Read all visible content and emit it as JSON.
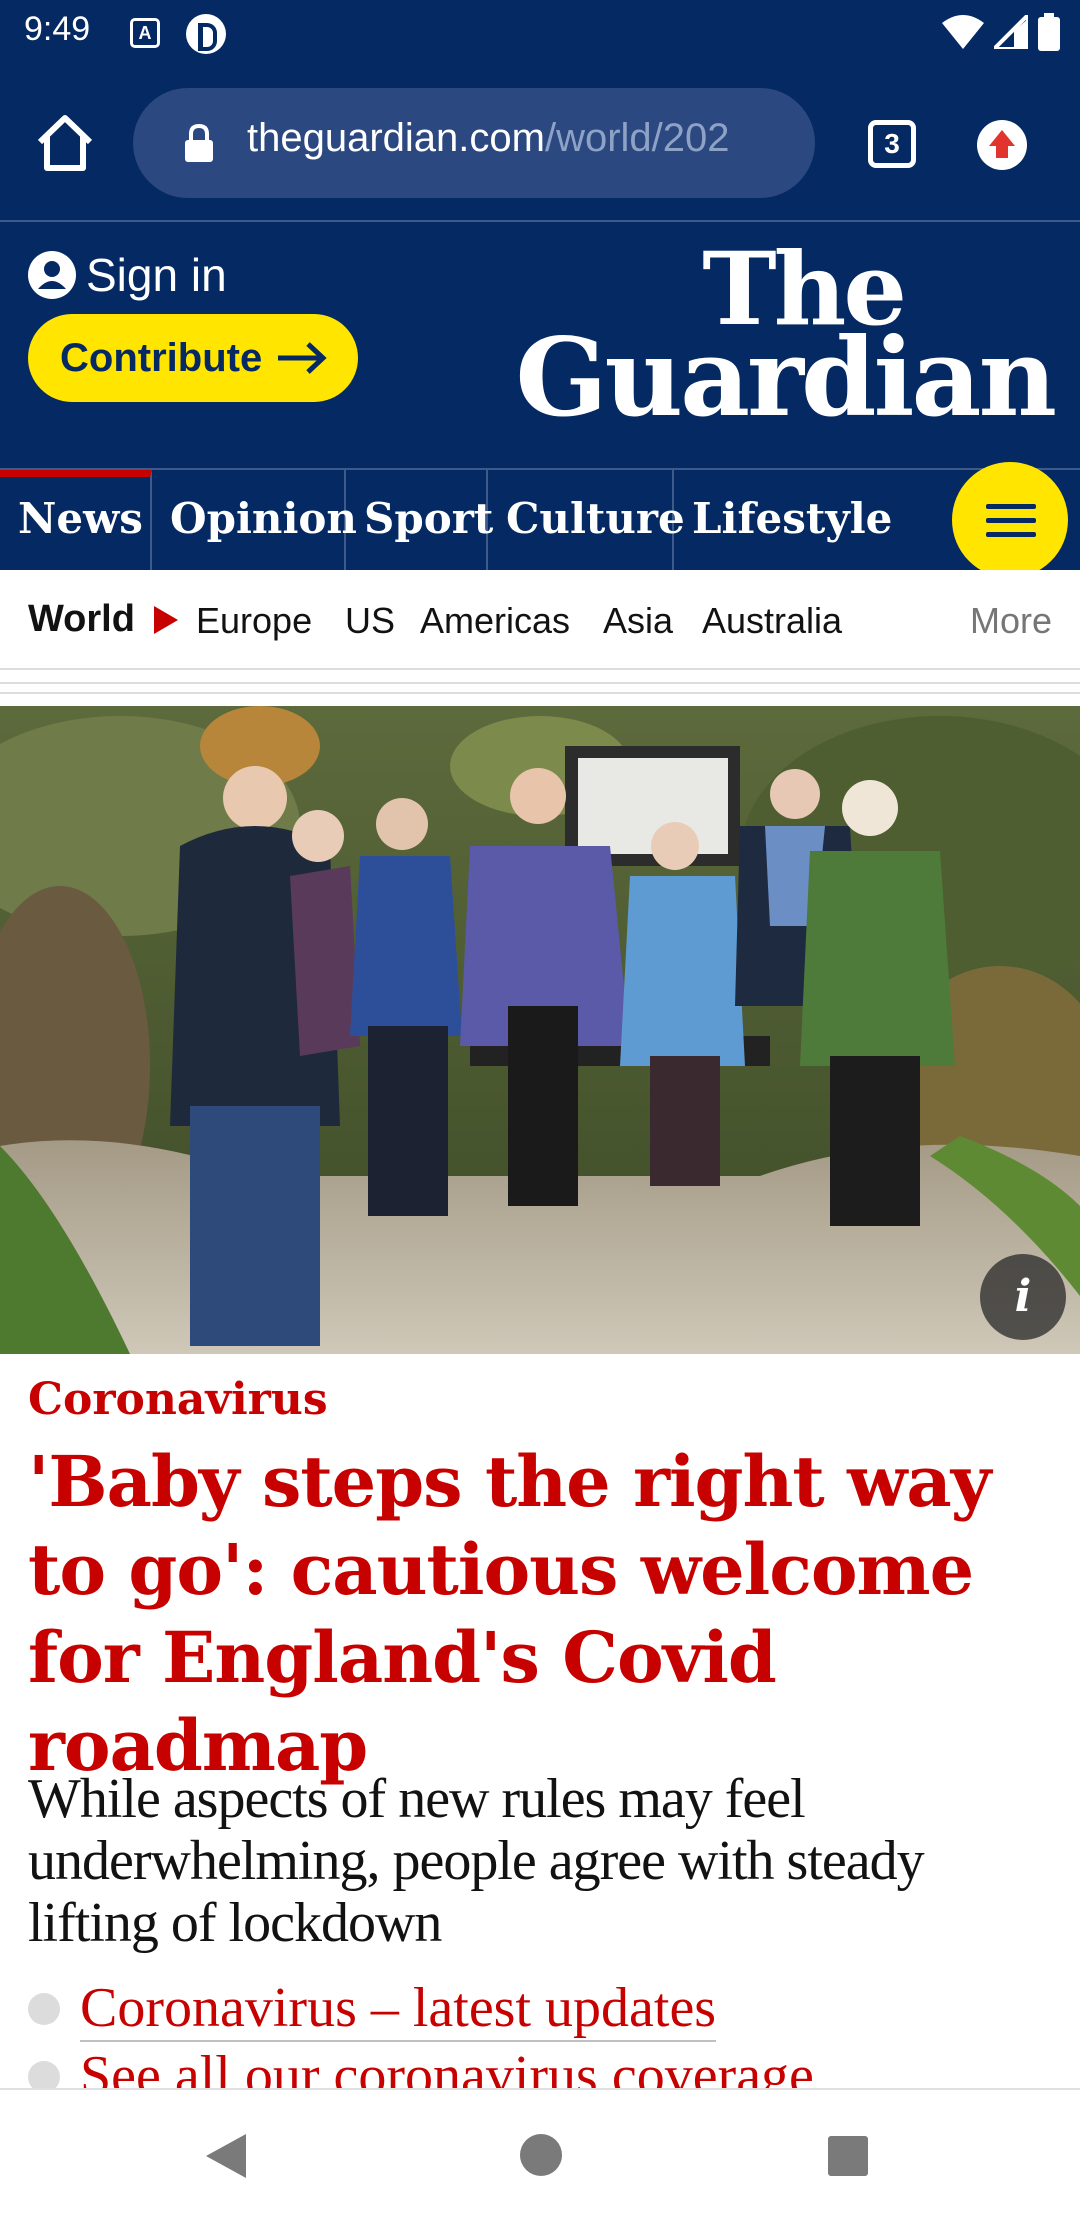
{
  "status_bar": {
    "time": "9:49",
    "icon_a": "A"
  },
  "browser": {
    "url_domain": "theguardian.com",
    "url_path": "/world/202",
    "tab_count": "3"
  },
  "header": {
    "sign_in": "Sign in",
    "contribute": "Contribute",
    "logo_line1": "The",
    "logo_line2": "Guardian"
  },
  "nav": {
    "items": [
      {
        "label": "News"
      },
      {
        "label": "Opinion"
      },
      {
        "label": "Sport"
      },
      {
        "label": "Culture"
      },
      {
        "label": "Lifestyle"
      }
    ]
  },
  "subnav": {
    "section": "World",
    "items": [
      "Europe",
      "US",
      "Americas",
      "Asia",
      "Australia"
    ],
    "more": "More"
  },
  "article": {
    "kicker": "Coronavirus",
    "headline": "'Baby steps the right way to go': cautious welcome for England's Covid roadmap",
    "standfirst": "While aspects of new rules may feel underwhelming, people agree with steady lifting of lockdown",
    "links": [
      "Coronavirus – latest updates",
      "See all our coronavirus coverage"
    ]
  },
  "colors": {
    "guardian_blue": "#052962",
    "news_red": "#c70000",
    "contribute_yellow": "#ffe500"
  }
}
